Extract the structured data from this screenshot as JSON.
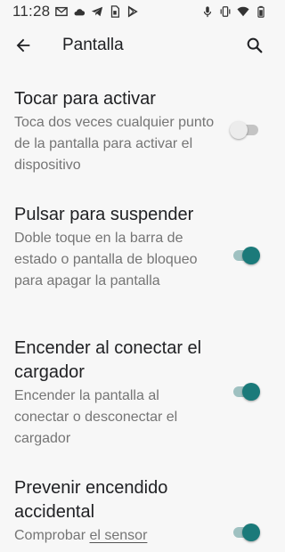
{
  "status_bar": {
    "time": "11:28",
    "left_icons": [
      "gmail-icon",
      "cloud-icon",
      "telegram-icon",
      "sim-icon",
      "play-icon"
    ],
    "right_icons": [
      "mic-icon",
      "vibrate-icon",
      "wifi-icon",
      "battery-icon"
    ]
  },
  "app_bar": {
    "title": "Pantalla"
  },
  "settings": [
    {
      "title": "Tocar para activar",
      "summary": "Toca dos veces cualquier punto de la pantalla para activar el dispositivo",
      "enabled": false
    },
    {
      "title": "Pulsar para suspender",
      "summary": "Doble toque en la barra de estado o pantalla de bloqueo para apagar la pantalla",
      "enabled": true
    },
    {
      "title": "Encender al conectar el cargador",
      "summary": "Encender la pantalla al conectar o desconectar el cargador",
      "enabled": true
    },
    {
      "title": "Prevenir encendido accidental",
      "summary_prefix": "Comprobar ",
      "summary_link": "el sensor",
      "enabled": true
    }
  ],
  "colors": {
    "background": "#f7f7f7",
    "accent": "#1b7a7a",
    "accent_track": "#9fc1c1",
    "off_track": "#c4c4c4",
    "summary_text": "#757575"
  }
}
